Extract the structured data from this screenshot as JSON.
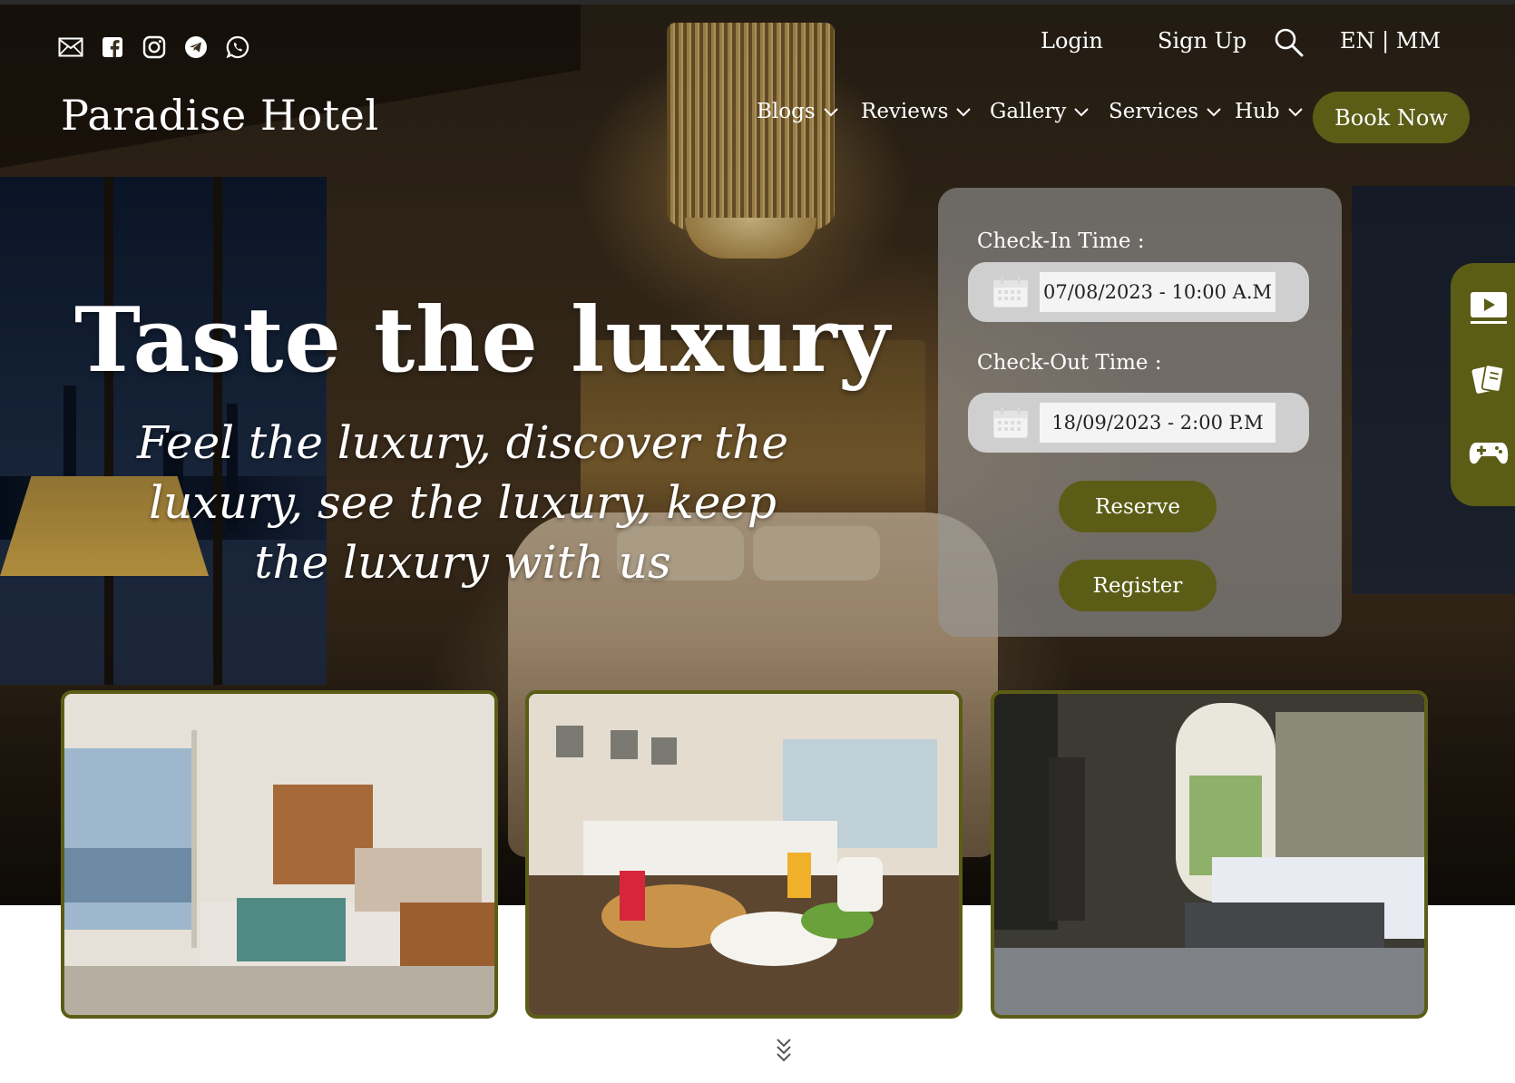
{
  "brand": {
    "name": "Paradise Hotel"
  },
  "top_bar": {
    "social_icons": [
      "mail-icon",
      "facebook-icon",
      "instagram-icon",
      "telegram-icon",
      "whatsapp-icon"
    ],
    "login": "Login",
    "sign_up": "Sign Up",
    "language": "EN | MM"
  },
  "nav": {
    "items": [
      {
        "label": "Blogs"
      },
      {
        "label": "Reviews"
      },
      {
        "label": "Gallery"
      },
      {
        "label": "Services"
      },
      {
        "label": "Hub"
      }
    ],
    "book_now": "Book Now"
  },
  "hero": {
    "headline": "Taste the luxury",
    "tagline_lines": [
      "Feel the luxury, discover the",
      "luxury, see the luxury, keep",
      "the luxury with us"
    ]
  },
  "booking": {
    "check_in_label": "Check-In Time :",
    "check_in_value": "07/08/2023 - 10:00 A.M",
    "check_out_label": "Check-Out Time :",
    "check_out_value": "18/09/2023 - 2:00 P.M",
    "reserve": "Reserve",
    "register": "Register"
  },
  "side_dock": [
    "video-icon",
    "game-cards-icon",
    "gamepad-icon"
  ],
  "cards": [
    "hotel-suite-photo",
    "breakfast-room-photo",
    "classic-bedroom-photo"
  ],
  "colors": {
    "accent": "#5b5d16",
    "panel": "#969696",
    "text": "#ffffff"
  }
}
